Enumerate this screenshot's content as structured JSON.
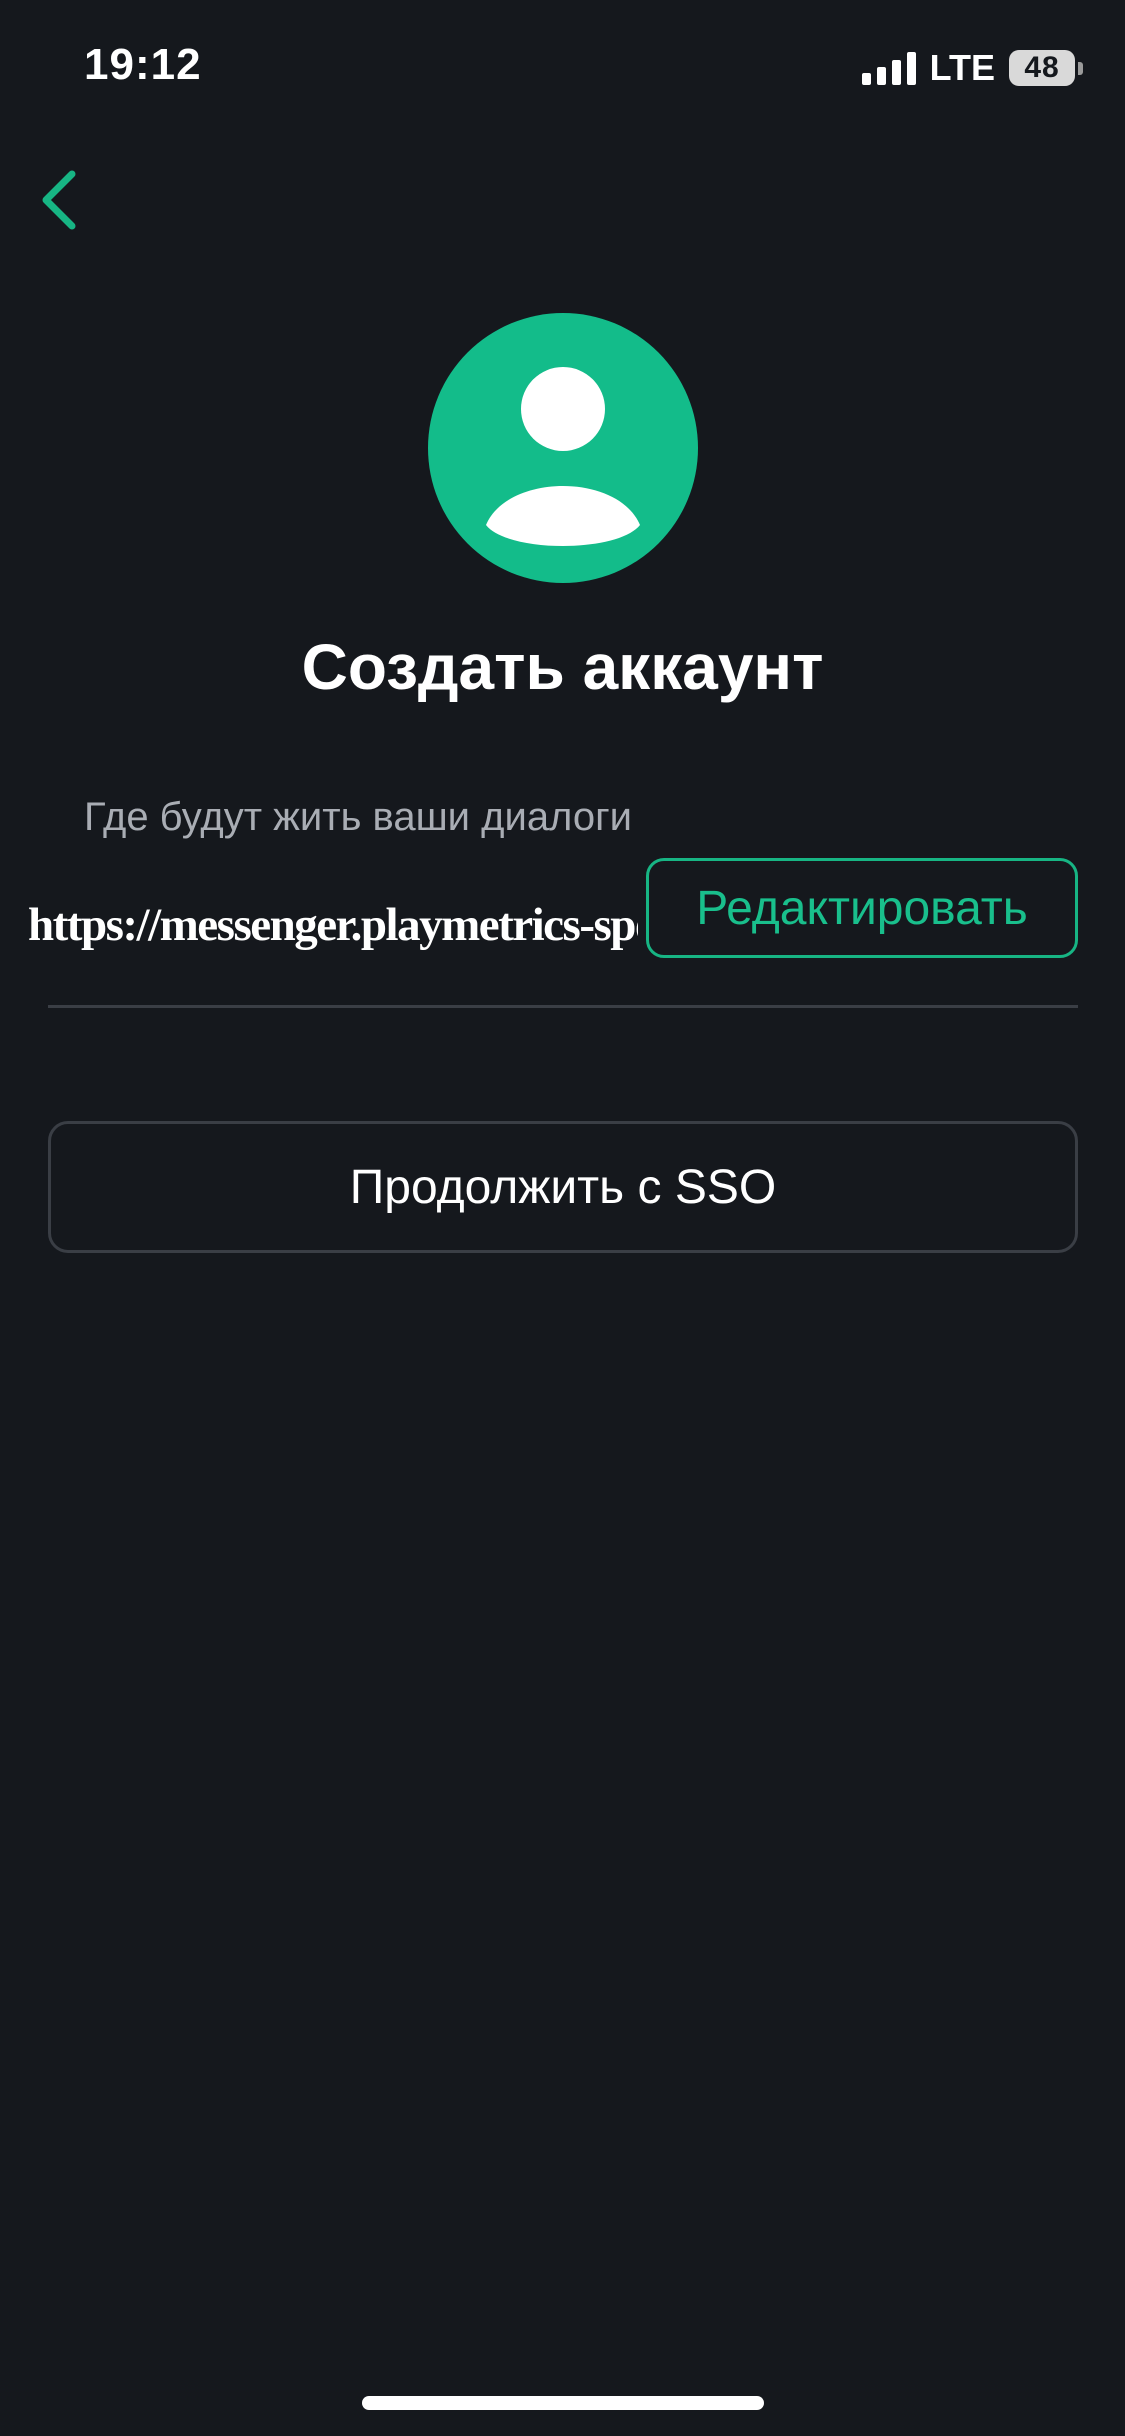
{
  "status_bar": {
    "time": "19:12",
    "network": "LTE",
    "battery": "48"
  },
  "header": {
    "back_icon": "chevron-left-icon"
  },
  "avatar": {
    "icon": "user-icon",
    "color": "#13bc8a"
  },
  "title": "Создать аккаунт",
  "server": {
    "caption": "Где будут жить ваши диалоги",
    "url": "https://messenger.playmetrics-sport.ru",
    "edit_label": "Редактировать"
  },
  "sso": {
    "label": "Продолжить с SSO"
  },
  "colors": {
    "background": "#15181d",
    "accent": "#17b584",
    "muted_text": "#a9adb4",
    "border": "#3a3e45"
  }
}
